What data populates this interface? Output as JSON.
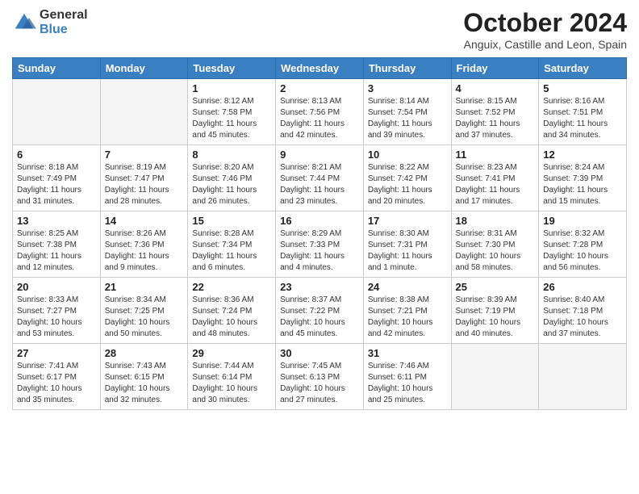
{
  "header": {
    "logo_general": "General",
    "logo_blue": "Blue",
    "title": "October 2024",
    "subtitle": "Anguix, Castille and Leon, Spain"
  },
  "calendar": {
    "days_of_week": [
      "Sunday",
      "Monday",
      "Tuesday",
      "Wednesday",
      "Thursday",
      "Friday",
      "Saturday"
    ],
    "weeks": [
      [
        {
          "day": "",
          "info": ""
        },
        {
          "day": "",
          "info": ""
        },
        {
          "day": "1",
          "info": "Sunrise: 8:12 AM\nSunset: 7:58 PM\nDaylight: 11 hours and 45 minutes."
        },
        {
          "day": "2",
          "info": "Sunrise: 8:13 AM\nSunset: 7:56 PM\nDaylight: 11 hours and 42 minutes."
        },
        {
          "day": "3",
          "info": "Sunrise: 8:14 AM\nSunset: 7:54 PM\nDaylight: 11 hours and 39 minutes."
        },
        {
          "day": "4",
          "info": "Sunrise: 8:15 AM\nSunset: 7:52 PM\nDaylight: 11 hours and 37 minutes."
        },
        {
          "day": "5",
          "info": "Sunrise: 8:16 AM\nSunset: 7:51 PM\nDaylight: 11 hours and 34 minutes."
        }
      ],
      [
        {
          "day": "6",
          "info": "Sunrise: 8:18 AM\nSunset: 7:49 PM\nDaylight: 11 hours and 31 minutes."
        },
        {
          "day": "7",
          "info": "Sunrise: 8:19 AM\nSunset: 7:47 PM\nDaylight: 11 hours and 28 minutes."
        },
        {
          "day": "8",
          "info": "Sunrise: 8:20 AM\nSunset: 7:46 PM\nDaylight: 11 hours and 26 minutes."
        },
        {
          "day": "9",
          "info": "Sunrise: 8:21 AM\nSunset: 7:44 PM\nDaylight: 11 hours and 23 minutes."
        },
        {
          "day": "10",
          "info": "Sunrise: 8:22 AM\nSunset: 7:42 PM\nDaylight: 11 hours and 20 minutes."
        },
        {
          "day": "11",
          "info": "Sunrise: 8:23 AM\nSunset: 7:41 PM\nDaylight: 11 hours and 17 minutes."
        },
        {
          "day": "12",
          "info": "Sunrise: 8:24 AM\nSunset: 7:39 PM\nDaylight: 11 hours and 15 minutes."
        }
      ],
      [
        {
          "day": "13",
          "info": "Sunrise: 8:25 AM\nSunset: 7:38 PM\nDaylight: 11 hours and 12 minutes."
        },
        {
          "day": "14",
          "info": "Sunrise: 8:26 AM\nSunset: 7:36 PM\nDaylight: 11 hours and 9 minutes."
        },
        {
          "day": "15",
          "info": "Sunrise: 8:28 AM\nSunset: 7:34 PM\nDaylight: 11 hours and 6 minutes."
        },
        {
          "day": "16",
          "info": "Sunrise: 8:29 AM\nSunset: 7:33 PM\nDaylight: 11 hours and 4 minutes."
        },
        {
          "day": "17",
          "info": "Sunrise: 8:30 AM\nSunset: 7:31 PM\nDaylight: 11 hours and 1 minute."
        },
        {
          "day": "18",
          "info": "Sunrise: 8:31 AM\nSunset: 7:30 PM\nDaylight: 10 hours and 58 minutes."
        },
        {
          "day": "19",
          "info": "Sunrise: 8:32 AM\nSunset: 7:28 PM\nDaylight: 10 hours and 56 minutes."
        }
      ],
      [
        {
          "day": "20",
          "info": "Sunrise: 8:33 AM\nSunset: 7:27 PM\nDaylight: 10 hours and 53 minutes."
        },
        {
          "day": "21",
          "info": "Sunrise: 8:34 AM\nSunset: 7:25 PM\nDaylight: 10 hours and 50 minutes."
        },
        {
          "day": "22",
          "info": "Sunrise: 8:36 AM\nSunset: 7:24 PM\nDaylight: 10 hours and 48 minutes."
        },
        {
          "day": "23",
          "info": "Sunrise: 8:37 AM\nSunset: 7:22 PM\nDaylight: 10 hours and 45 minutes."
        },
        {
          "day": "24",
          "info": "Sunrise: 8:38 AM\nSunset: 7:21 PM\nDaylight: 10 hours and 42 minutes."
        },
        {
          "day": "25",
          "info": "Sunrise: 8:39 AM\nSunset: 7:19 PM\nDaylight: 10 hours and 40 minutes."
        },
        {
          "day": "26",
          "info": "Sunrise: 8:40 AM\nSunset: 7:18 PM\nDaylight: 10 hours and 37 minutes."
        }
      ],
      [
        {
          "day": "27",
          "info": "Sunrise: 7:41 AM\nSunset: 6:17 PM\nDaylight: 10 hours and 35 minutes."
        },
        {
          "day": "28",
          "info": "Sunrise: 7:43 AM\nSunset: 6:15 PM\nDaylight: 10 hours and 32 minutes."
        },
        {
          "day": "29",
          "info": "Sunrise: 7:44 AM\nSunset: 6:14 PM\nDaylight: 10 hours and 30 minutes."
        },
        {
          "day": "30",
          "info": "Sunrise: 7:45 AM\nSunset: 6:13 PM\nDaylight: 10 hours and 27 minutes."
        },
        {
          "day": "31",
          "info": "Sunrise: 7:46 AM\nSunset: 6:11 PM\nDaylight: 10 hours and 25 minutes."
        },
        {
          "day": "",
          "info": ""
        },
        {
          "day": "",
          "info": ""
        }
      ]
    ]
  }
}
